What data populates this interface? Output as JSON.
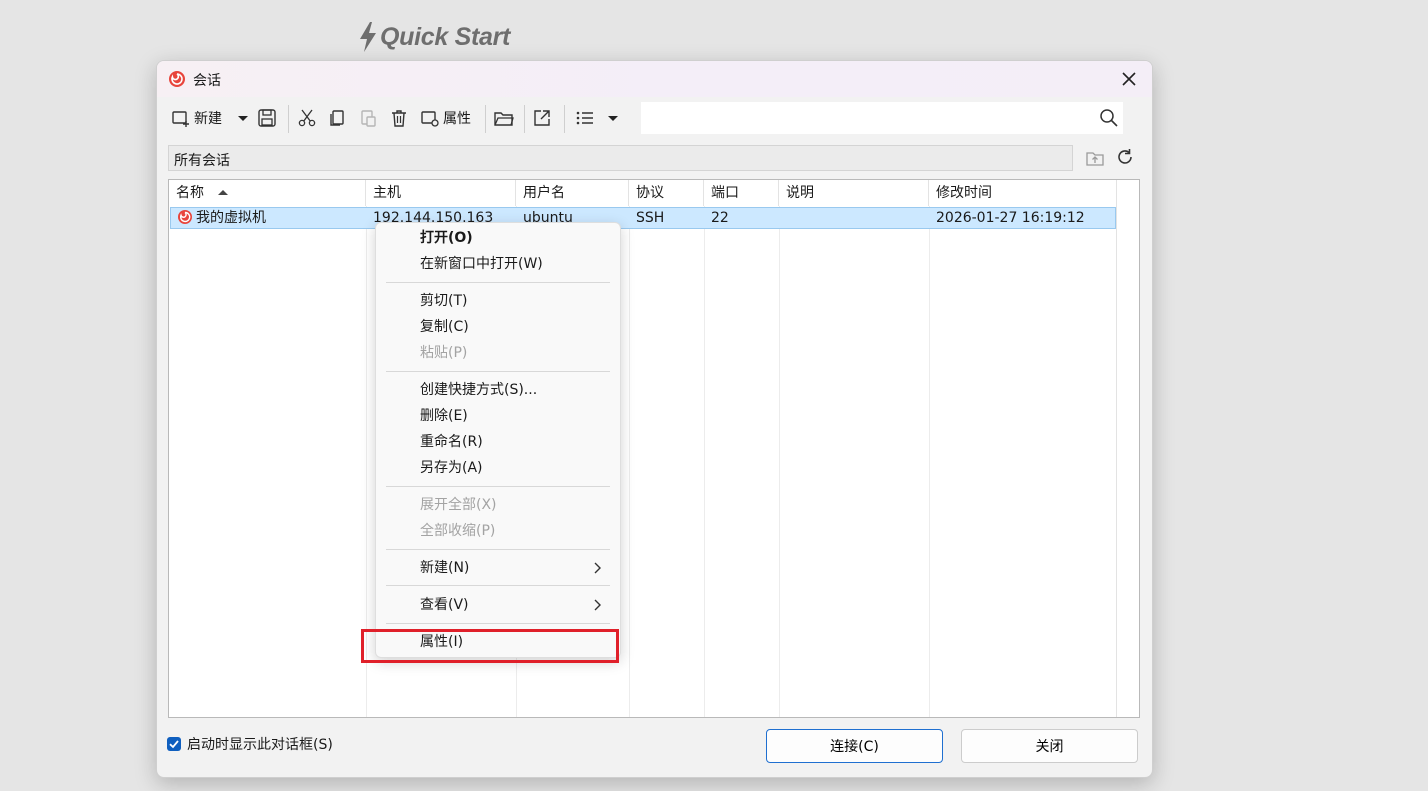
{
  "banner": {
    "title": "Quick Start"
  },
  "dialog": {
    "title": "会话",
    "toolbar": {
      "new_label": "新建",
      "properties_label": "属性"
    },
    "search": {
      "value": "",
      "placeholder": ""
    },
    "path": {
      "label": "所有会话"
    },
    "table": {
      "columns": [
        "名称",
        "主机",
        "用户名",
        "协议",
        "端口",
        "说明",
        "修改时间"
      ],
      "rows": [
        {
          "name": "我的虚拟机",
          "host": "192.144.150.163",
          "user": "ubuntu",
          "protocol": "SSH",
          "port": "22",
          "desc": "",
          "modified": "2026-01-27 16:19:12"
        }
      ]
    },
    "context_menu": {
      "open": "打开(O)",
      "open_new_window": "在新窗口中打开(W)",
      "cut": "剪切(T)",
      "copy": "复制(C)",
      "paste": "粘贴(P)",
      "create_shortcut": "创建快捷方式(S)...",
      "delete": "删除(E)",
      "rename": "重命名(R)",
      "save_as": "另存为(A)",
      "expand_all": "展开全部(X)",
      "collapse_all": "全部收缩(P)",
      "new": "新建(N)",
      "view": "查看(V)",
      "properties": "属性(I)"
    },
    "footer": {
      "show_on_startup": "启动时显示此对话框(S)",
      "show_on_startup_checked": true,
      "connect": "连接(C)",
      "close": "关闭"
    }
  },
  "colors": {
    "selection": "#cce8ff",
    "accent": "#1f6fd0",
    "highlight": "#e0202a"
  }
}
